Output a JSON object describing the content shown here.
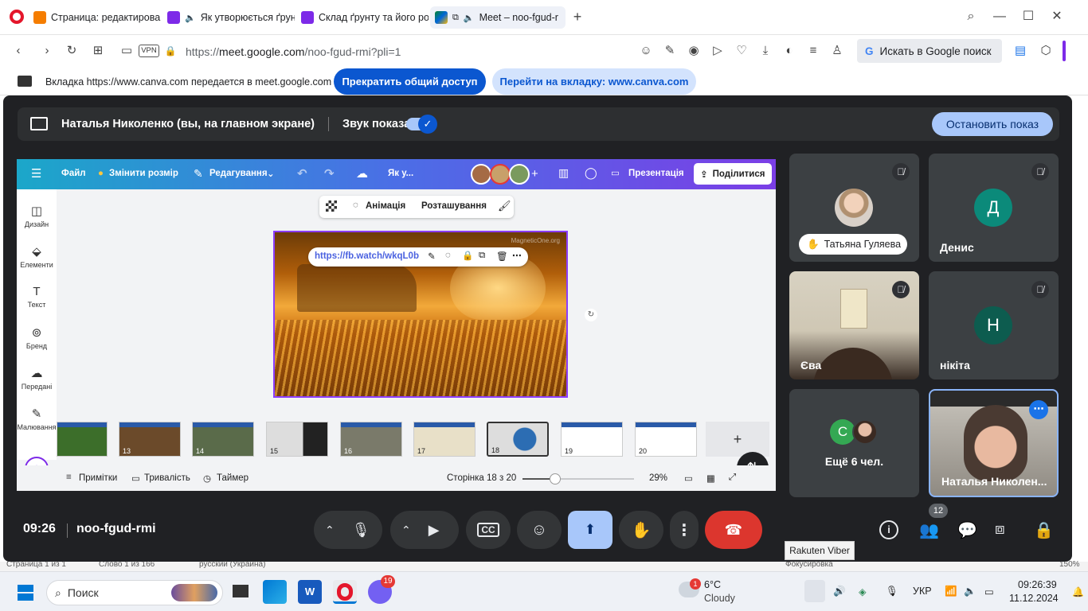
{
  "browser": {
    "tabs": [
      {
        "title": "Страница: редактирован",
        "active": false
      },
      {
        "title": "Як утворюється ґрунт",
        "active": false
      },
      {
        "title": "Склад ґрунту та його род",
        "active": false
      },
      {
        "title": "Meet – noo-fgud-r",
        "active": true
      }
    ],
    "new_tab": "+",
    "vpn_label": "VPN",
    "url_prefix": "https://",
    "url_host": "meet.google.com",
    "url_path": "/noo-fgud-rmi?pli=1",
    "search_label": "Искать в Google поиск"
  },
  "share_notice": {
    "text": "Вкладка https://www.canva.com передается в meet.google.com",
    "stop_label": "Прекратить общий доступ",
    "goto_label": "Перейти на вкладку: www.canva.com"
  },
  "presenting_bar": {
    "presenter": "Наталья Николенко (вы, на главном экране)",
    "sound_label": "Звук показа",
    "sound_on": true,
    "stop_label": "Остановить показ"
  },
  "canva": {
    "menu": {
      "file": "Файл",
      "resize": "Змінити розмір",
      "editing": "Редагування",
      "title": "Як у...",
      "present": "Презентація",
      "share": "Поділитися"
    },
    "side": [
      "Дизайн",
      "Елементи",
      "Текст",
      "Бренд",
      "Передані",
      "Малювання"
    ],
    "element_toolbar": {
      "animation": "Анімація",
      "position": "Розташування"
    },
    "link": "https://fb.watch/wkqL0b",
    "watermark": "MagneticOne.org",
    "thumb_numbers": [
      "13",
      "14",
      "15",
      "16",
      "17",
      "18",
      "19",
      "20"
    ],
    "footer": {
      "notes": "Примітки",
      "duration": "Тривалість",
      "timer": "Таймер",
      "page": "Сторінка 18 з 20",
      "zoom": "29%",
      "zoom_level": 0.29
    }
  },
  "participants": [
    {
      "name": "Татьяна Гуляева",
      "muted": true
    },
    {
      "name": "Денис",
      "initial": "Д",
      "muted": true,
      "color": "#0b8a7a"
    },
    {
      "name": "Єва",
      "muted": true
    },
    {
      "name": "нікіта",
      "initial": "Н",
      "muted": true,
      "color": "#0d5c4f"
    },
    {
      "name": "Ещё 6 чел.",
      "initial": "C"
    },
    {
      "name": "Наталья Николен...",
      "active": true
    }
  ],
  "meeting": {
    "time": "09:26",
    "code": "noo-fgud-rmi",
    "people_count": "12",
    "tooltip": "Rakuten Viber"
  },
  "taskbar": {
    "search": "Поиск",
    "viber_badge": "19",
    "weather_badge": "1",
    "temp": "6°C",
    "weather": "Cloudy",
    "lang": "УКР",
    "clock": "09:26:39",
    "date": "11.12.2024",
    "under_left": "Страница 1 из 1",
    "under_words": "Слово 1 из 166",
    "under_lang": "русский (Украина)",
    "under_focus": "Фокусировка",
    "under_zoom": "150%"
  }
}
